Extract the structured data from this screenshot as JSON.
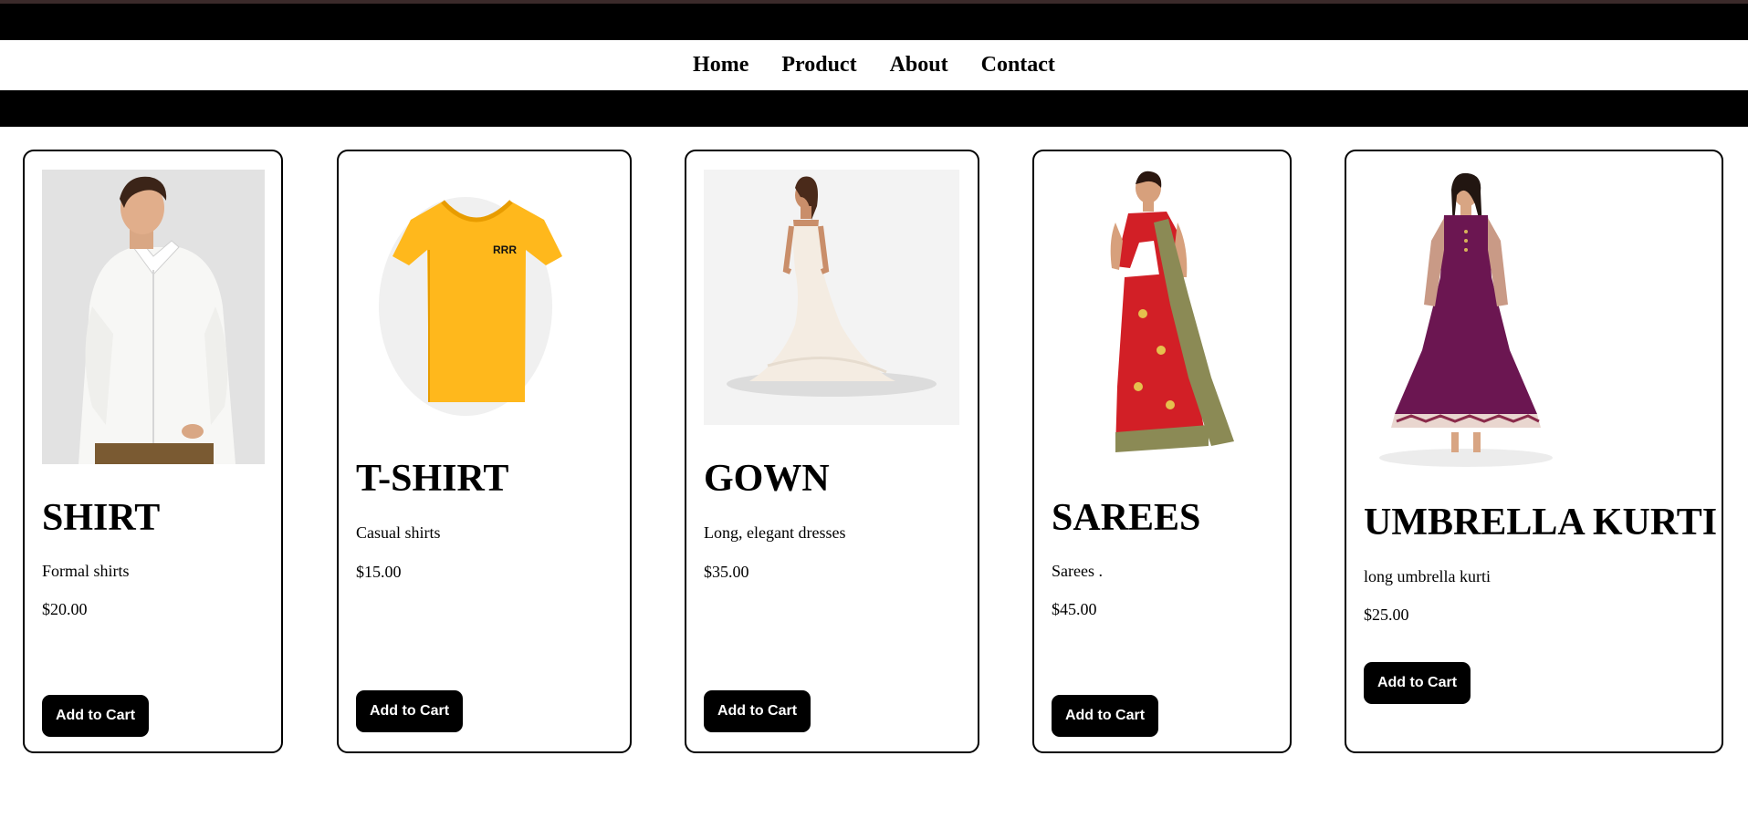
{
  "nav": {
    "links": [
      "Home",
      "Product",
      "About",
      "Contact"
    ]
  },
  "products": [
    {
      "title": "SHIRT",
      "description": "Formal shirts",
      "price": "$20.00",
      "button": "Add to Cart",
      "image": "shirt-photo"
    },
    {
      "title": "T-SHIRT",
      "description": "Casual shirts",
      "price": "$15.00",
      "button": "Add to Cart",
      "image": "tshirt-photo"
    },
    {
      "title": "GOWN",
      "description": "Long, elegant dresses",
      "price": "$35.00",
      "button": "Add to Cart",
      "image": "gown-photo"
    },
    {
      "title": "SAREES",
      "description": "Sarees .",
      "price": "$45.00",
      "button": "Add to Cart",
      "image": "saree-photo"
    },
    {
      "title": "UMBRELLA KURTI",
      "description": "long umbrella kurti",
      "price": "$25.00",
      "button": "Add to Cart",
      "image": "kurti-photo"
    }
  ],
  "colors": {
    "header": "#000000",
    "button": "#000000",
    "tshirt": "#FFB81C",
    "saree_red": "#D21F26",
    "saree_gold": "#8B8A55",
    "kurti": "#6B1651"
  }
}
